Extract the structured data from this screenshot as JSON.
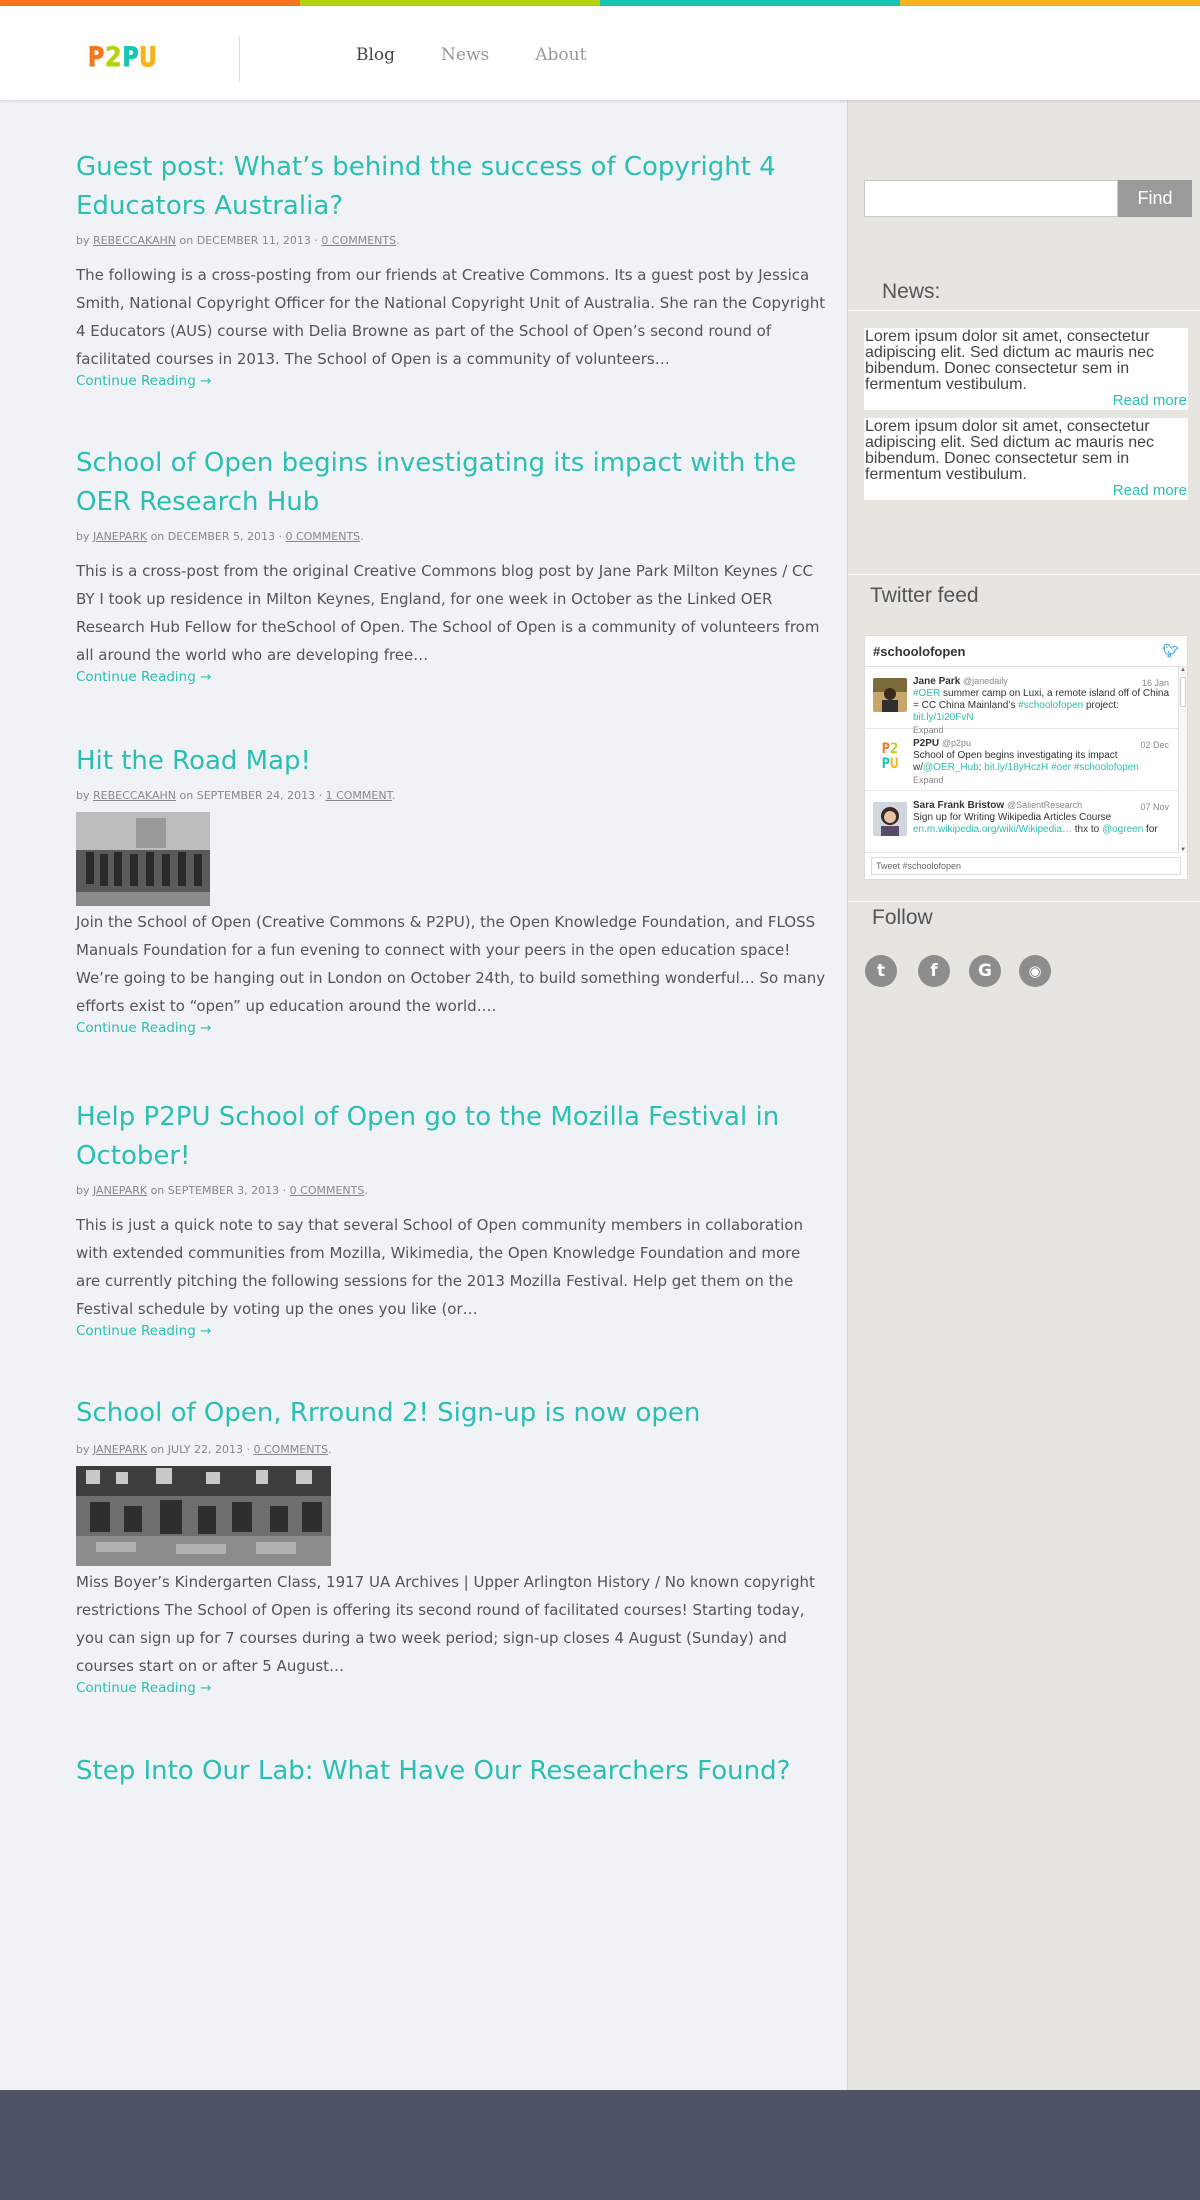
{
  "colors": {
    "accent": "#29bfb2",
    "stripe": [
      "#f7751f",
      "#b3d30f",
      "#16c5b2",
      "#f7b31d"
    ],
    "footer": "#4e5466"
  },
  "logo": {
    "letters": [
      "P",
      "2",
      "P",
      "U"
    ],
    "colors": [
      "#f7751f",
      "#b3d30f",
      "#16c5b2",
      "#f7b31d"
    ]
  },
  "nav": [
    {
      "label": "Blog"
    },
    {
      "label": "News"
    },
    {
      "label": "About"
    }
  ],
  "posts": [
    {
      "title": "Guest post: What’s behind the success of Copyright 4 Educators Australia?",
      "by": "by",
      "author": "REBECCAKAHN",
      "on": "on",
      "date": "DECEMBER 11, 2013",
      "sep": "·",
      "comments": "0 COMMENTS",
      "end": ".",
      "excerpt": "The following is a cross-posting from our friends at Creative Commons. Its a guest post by Jessica Smith, National Copyright Officer for the National Copyright Unit of Australia. She ran the Copyright 4 Educators (AUS) course with Delia Browne as part of the School of Open’s second round of facilitated courses in 2013. The School of Open is a community of volunteers…",
      "more": "Continue Reading →"
    },
    {
      "title": "School of Open begins investigating its impact with the OER Research Hub",
      "by": "by",
      "author": "JANEPARK",
      "on": "on",
      "date": "DECEMBER 5, 2013",
      "sep": "·",
      "comments": "0 COMMENTS",
      "end": ".",
      "excerpt": "This is a cross-post from the original Creative Commons blog post by Jane Park Milton Keynes / CC BY I took up residence in Milton Keynes, England, for one week in October as the Linked OER Research Hub Fellow for theSchool of Open. The School of Open is a community of volunteers from all around the world who are developing free…",
      "more": "Continue Reading →"
    },
    {
      "title": "Hit the Road Map!",
      "by": "by",
      "author": "REBECCAKAHN",
      "on": "on",
      "date": "SEPTEMBER 24, 2013",
      "sep": "·",
      "comments": "1 COMMENT",
      "end": ".",
      "excerpt": "Join the School of Open (Creative Commons & P2PU), the Open Knowledge Foundation, and FLOSS Manuals Foundation for a fun evening to connect with your peers in the open education space! We’re going to be hanging out in London on October 24th, to build something wonderful… So many efforts exist to “open” up education around the world.…",
      "more": "Continue Reading →"
    },
    {
      "title": "Help P2PU School of Open go to the Mozilla Festival in October!",
      "by": "by",
      "author": "JANEPARK",
      "on": "on",
      "date": "SEPTEMBER 3, 2013",
      "sep": "·",
      "comments": "0 COMMENTS",
      "end": ".",
      "excerpt": "This is just a quick note to say that several School of Open community members in collaboration with extended communities from Mozilla, Wikimedia, the Open Knowledge Foundation and more are currently pitching the following sessions for the 2013 Mozilla Festival. Help get them on the Festival schedule by voting up the ones you like (or…",
      "more": "Continue Reading →"
    },
    {
      "title": "School of Open, Rrround 2! Sign-up is now open",
      "by": "by",
      "author": "JANEPARK",
      "on": "on",
      "date": "JULY 22, 2013",
      "sep": "·",
      "comments": "0 COMMENTS",
      "end": ".",
      "excerpt": "Miss Boyer’s Kindergarten Class, 1917 UA Archives | Upper Arlington History / No known copyright restrictions The School of Open is offering its second round of facilitated courses! Starting today, you can sign up for 7 courses during a two week period; sign-up closes 4 August (Sunday) and courses start on or after 5 August…",
      "more": "Continue Reading →"
    },
    {
      "title": "Step Into Our Lab: What Have Our Researchers Found?"
    }
  ],
  "sidebar": {
    "search": {
      "placeholder": "",
      "button": "Find"
    },
    "news_heading": "News:",
    "news": [
      {
        "text": "Lorem ipsum dolor sit amet, consectetur adipiscing elit. Sed dictum ac mauris nec bibendum. Donec consectetur sem in fermentum vestibulum.",
        "more": "Read more"
      },
      {
        "text": "Lorem ipsum dolor sit amet, consectetur adipiscing elit. Sed dictum ac mauris nec bibendum. Donec consectetur sem in fermentum vestibulum.",
        "more": "Read more"
      }
    ],
    "twitter_heading": "Twitter feed",
    "twitter": {
      "hashtag": "#schoolofopen",
      "tweets": [
        {
          "name": "Jane Park",
          "handle": "@janedaily",
          "date": "16 Jan",
          "pre": "",
          "link1": "#OER",
          "mid": " summer camp on Luxi, a remote island off of China = CC China Mainland’s ",
          "link2": "#schoolofopen",
          "post": " project:",
          "link3": "bit.ly/1i20FvN",
          "expand": "Expand"
        },
        {
          "name": "P2PU",
          "handle": "@p2pu",
          "date": "02 Dec",
          "pre": "School of Open begins investigating its impact w/",
          "link1": "@OER_Hub",
          "mid": ": ",
          "link2": "bit.ly/18yHczH #oer #schoolofopen",
          "post": "",
          "link3": "",
          "expand": "Expand"
        },
        {
          "name": "Sara Frank Bristow",
          "handle": "@SalientResearch",
          "date": "07 Nov",
          "pre": "Sign up for Writing Wikipedia Articles Course",
          "link1": "",
          "mid": "",
          "link2": "en.m.wikipedia.org/wiki/Wikipedia…",
          "post": " thx to ",
          "link3": "@ogreen",
          "tail": " for",
          "expand": ""
        }
      ],
      "tweet_box": "Tweet #schoolofopen"
    },
    "follow_heading": "Follow",
    "social": [
      {
        "icon": "twitter-icon",
        "glyph": "t"
      },
      {
        "icon": "facebook-icon",
        "glyph": "f"
      },
      {
        "icon": "google-icon",
        "glyph": "G"
      },
      {
        "icon": "rss-icon",
        "glyph": "◉"
      }
    ]
  }
}
